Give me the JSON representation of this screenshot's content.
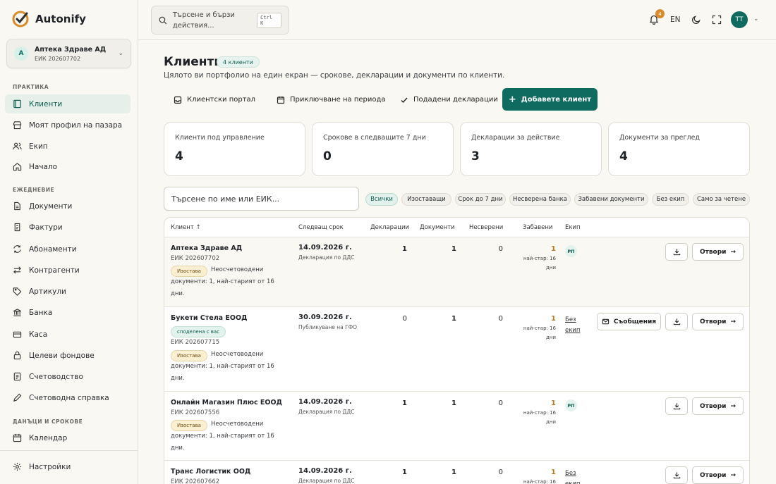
{
  "app": {
    "name": "Autonify"
  },
  "company": {
    "initial": "А",
    "name": "Аптека Здраве АД",
    "eik": "ЕИК 202607702"
  },
  "sidebar": {
    "sections": {
      "practice": "ПРАКТИКА",
      "daily": "ЕЖЕДНЕВИЕ",
      "taxes": "ДАНЪЦИ И СРОКОВЕ"
    },
    "items": [
      {
        "label": "Клиенти",
        "icon": "book-icon",
        "active": true
      },
      {
        "label": "Моят профил на пазара",
        "icon": "store-icon"
      },
      {
        "label": "Екип",
        "icon": "users-icon"
      },
      {
        "label": "Начало",
        "icon": "home-icon"
      },
      {
        "label": "Документи",
        "icon": "document-icon"
      },
      {
        "label": "Фактури",
        "icon": "receipt-icon"
      },
      {
        "label": "Абонаменти",
        "icon": "repeat-icon"
      },
      {
        "label": "Контрагенти",
        "icon": "arrows-icon"
      },
      {
        "label": "Артикули",
        "icon": "tag-icon"
      },
      {
        "label": "Банка",
        "icon": "bank-icon"
      },
      {
        "label": "Каса",
        "icon": "cash-icon"
      },
      {
        "label": "Целеви фондове",
        "icon": "lock-icon"
      },
      {
        "label": "Счетоводство",
        "icon": "ledger-icon"
      },
      {
        "label": "Счетоводна справка",
        "icon": "pencil-icon"
      },
      {
        "label": "Календар",
        "icon": "calendar-icon"
      }
    ],
    "settings": "Настройки"
  },
  "topbar": {
    "search_placeholder": "Търсене и бързи действия...",
    "shortcut": "Ctrl K",
    "notifications": "4",
    "language": "EN",
    "user_initials": "ТТ"
  },
  "page": {
    "title": "Клиенти",
    "count_badge": "4 клиенти",
    "subtitle": "Цялото ви портфолио на един екран — срокове, декларации и документи по клиенти."
  },
  "actions": {
    "portal": "Клиентски портал",
    "close_period": "Приключване на периода",
    "submitted": "Подадени декларации",
    "add_client": "Добавете клиент"
  },
  "stats": [
    {
      "label": "Клиенти под управление",
      "value": "4"
    },
    {
      "label": "Срокове в следващите 7 дни",
      "value": "0"
    },
    {
      "label": "Декларации за действие",
      "value": "3"
    },
    {
      "label": "Документи за преглед",
      "value": "4"
    }
  ],
  "client_search": {
    "placeholder": "Търсене по име или ЕИК..."
  },
  "filters": [
    "Всички",
    "Изоставащи",
    "Срок до 7 дни",
    "Несверена банка",
    "Забавени документи",
    "Без екип",
    "Само за четене"
  ],
  "table": {
    "columns": {
      "client": "Клиент",
      "sort_arrow": "↑",
      "deadline": "Следващ срок",
      "declarations": "Декларации",
      "documents": "Документи",
      "unreconciled": "Несверени",
      "delayed": "Забавени",
      "team": "Екип"
    },
    "rows": [
      {
        "name": "Аптека Здраве АД",
        "eik": "ЕИК 202607702",
        "shared": "",
        "status": "Изостава",
        "note": "Неосчетоводени документи: 1, най-старият от 16 дни.",
        "deadline": "14.09.2026 г.",
        "deadline_type": "Декларация по ДДС",
        "declarations": "1",
        "documents": "1",
        "unreconciled": "0",
        "delayed": "1",
        "delayed_note": "най-стар: 16 дни",
        "team": "РП",
        "messages": "",
        "open": "Отвори"
      },
      {
        "name": "Букети Стела ЕООД",
        "eik": "ЕИК 202607715",
        "shared": "споделена с вас",
        "status": "Изостава",
        "note": "Неосчетоводени документи: 1, най-старият от 16 дни.",
        "deadline": "30.09.2026 г.",
        "deadline_type": "Публикуване на ГФО",
        "declarations": "0",
        "documents": "1",
        "unreconciled": "0",
        "delayed": "1",
        "delayed_note": "най-стар: 16 дни",
        "team": "Без екип",
        "messages": "Съобщения",
        "open": "Отвори"
      },
      {
        "name": "Онлайн Магазин Плюс ЕООД",
        "eik": "ЕИК 202607556",
        "shared": "",
        "status": "Изостава",
        "note": "Неосчетоводени документи: 1, най-старият от 16 дни.",
        "deadline": "14.09.2026 г.",
        "deadline_type": "Декларация по ДДС",
        "declarations": "1",
        "documents": "1",
        "unreconciled": "0",
        "delayed": "1",
        "delayed_note": "най-стар: 16 дни",
        "team": "РП",
        "messages": "",
        "open": "Отвори"
      },
      {
        "name": "Транс Логистик ООД",
        "eik": "ЕИК 202607662",
        "shared": "",
        "status": "",
        "note": "",
        "deadline": "14.09.2026 г.",
        "deadline_type": "Декларация по ДДС",
        "declarations": "1",
        "documents": "1",
        "unreconciled": "0",
        "delayed": "1",
        "delayed_note": "най-стар: 16",
        "team": "Без екип",
        "messages": "",
        "open": "Отвори"
      }
    ]
  }
}
